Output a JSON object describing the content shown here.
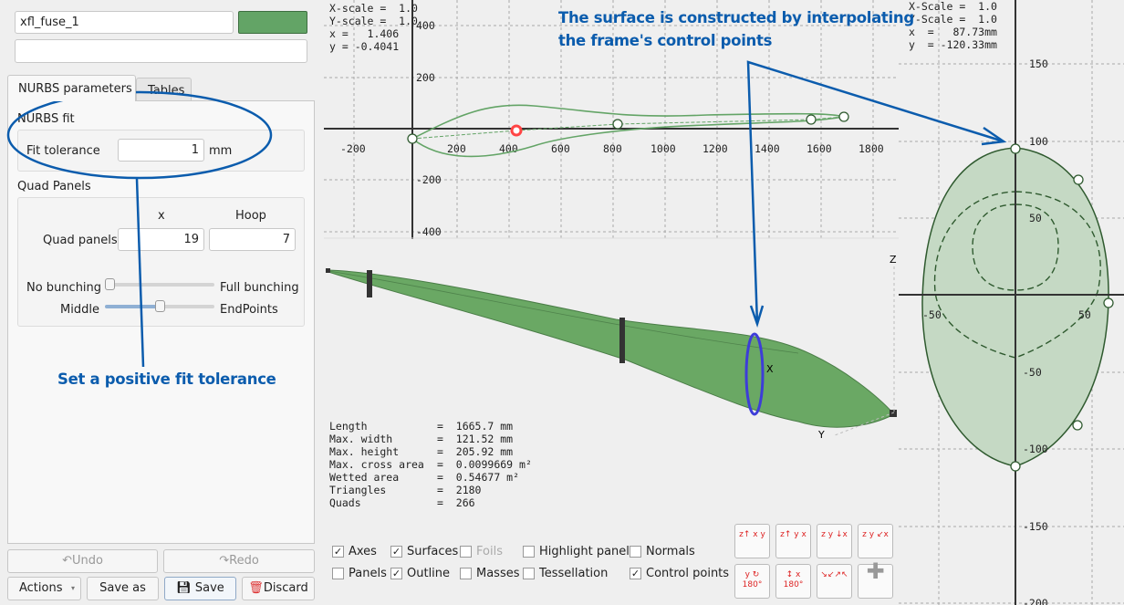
{
  "object": {
    "name": "xfl_fuse_1",
    "description": "",
    "color": "#63a466"
  },
  "tabs": [
    {
      "label": "NURBS parameters",
      "active": true
    },
    {
      "label": "Tables",
      "active": false
    }
  ],
  "nurbs_fit": {
    "title": "NURBS fit",
    "tolerance_label": "Fit tolerance",
    "tolerance_value": "1",
    "unit": "mm"
  },
  "quad_panels": {
    "title": "Quad Panels",
    "col_x": "x",
    "col_hoop": "Hoop",
    "row_label": "Quad panels",
    "x_value": "19",
    "hoop_value": "7",
    "bunching": {
      "left": "No bunching",
      "right": "Full bunching",
      "level": 0
    },
    "distribution": {
      "left": "Middle",
      "right": "EndPoints",
      "level": 0.5
    }
  },
  "buttons": {
    "undo": "Undo",
    "redo": "Redo",
    "actions": "Actions",
    "save_as": "Save as",
    "save": "Save",
    "discard": "Discard"
  },
  "side_view": {
    "xscale": "X-scale =  1.0",
    "yscale": "Y-scale =  1.0",
    "x": "x =   1.406",
    "y": "y = -0.4041",
    "x_ticks": [
      "-200",
      "200",
      "400",
      "600",
      "800",
      "1000",
      "1200",
      "1400",
      "1600",
      "1800"
    ],
    "y_ticks": [
      "400",
      "200",
      "-200",
      "-400"
    ]
  },
  "frame_view": {
    "xscale": "X-Scale =  1.0",
    "yscale": "Y-Scale =  1.0",
    "x": "x  =   87.73mm",
    "y": "y  = -120.33mm",
    "y_ticks": [
      "150",
      "100",
      "50",
      "-50",
      "-100",
      "-150",
      "-200"
    ],
    "x_ticks": [
      "-50",
      "50"
    ]
  },
  "view3d": {
    "axis_labels": [
      "Z",
      "X",
      "Y"
    ],
    "stats": [
      [
        "Length",
        "1665.7 mm"
      ],
      [
        "Max. width",
        "121.52 mm"
      ],
      [
        "Max. height",
        "205.92 mm"
      ],
      [
        "Max. cross area",
        "0.0099669 m²"
      ],
      [
        "Wetted area",
        "0.54677 m²"
      ],
      [
        "Triangles",
        "2180"
      ],
      [
        "Quads",
        "266"
      ]
    ]
  },
  "display_options": [
    {
      "label": "Axes",
      "checked": true
    },
    {
      "label": "Surfaces",
      "checked": true
    },
    {
      "label": "Foils",
      "checked": false,
      "disabled": true
    },
    {
      "label": "Highlight panel",
      "checked": false
    },
    {
      "label": "Normals",
      "checked": false
    },
    {
      "label": "Panels",
      "checked": false
    },
    {
      "label": "Outline",
      "checked": true
    },
    {
      "label": "Masses",
      "checked": false
    },
    {
      "label": "Tessellation",
      "checked": false
    },
    {
      "label": "Control points",
      "checked": true
    }
  ],
  "view_buttons": [
    "front-view-icon",
    "side-view-icon",
    "top-view-icon",
    "iso-view-icon",
    "rotate-y-180-icon",
    "rotate-x-180-icon",
    "reset-view-icon",
    "fit-cross-icon"
  ],
  "annotations": {
    "surface_note_1": "The surface is constructed by interpolating",
    "surface_note_2": "the frame's control points",
    "tolerance_note": "Set a positive fit tolerance"
  },
  "colors": {
    "annotation": "#0b5cad",
    "surface": "#6aa864",
    "highlight_point": "#ff4444"
  }
}
